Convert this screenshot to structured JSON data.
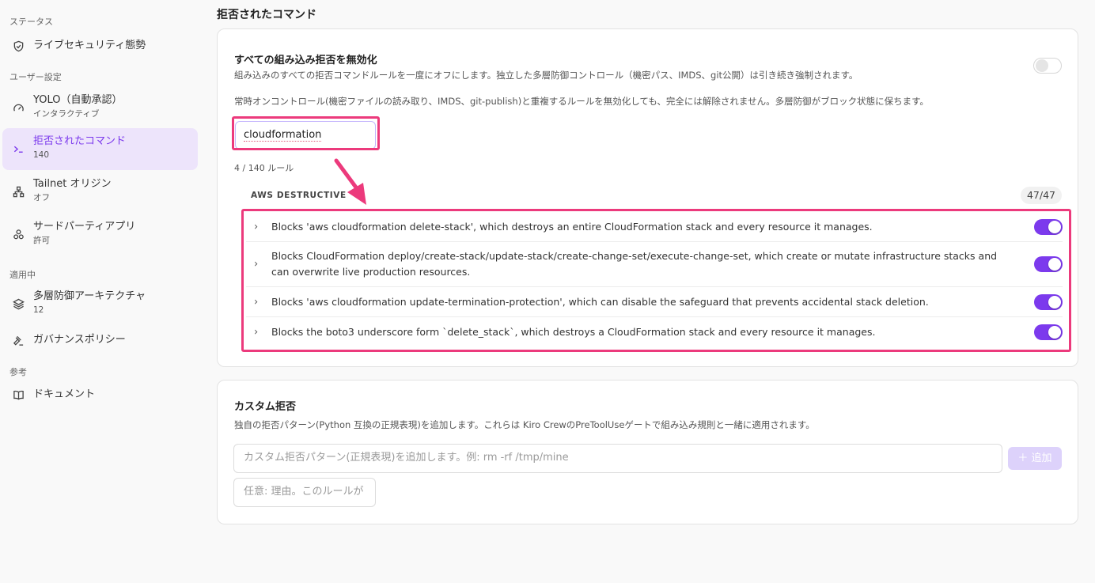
{
  "sidebar": {
    "sections": {
      "status": "ステータス",
      "user_settings": "ユーザー設定",
      "applied": "適用中",
      "reference": "参考"
    },
    "items": [
      {
        "label": "ライブセキュリティ態勢",
        "sub": "",
        "icon": "shield-icon"
      },
      {
        "label": "YOLO（自動承認）",
        "sub": "インタラクティブ",
        "icon": "gauge-icon"
      },
      {
        "label": "拒否されたコマンド",
        "sub": "140",
        "icon": "terminal-icon"
      },
      {
        "label": "Tailnet オリジン",
        "sub": "オフ",
        "icon": "network-icon"
      },
      {
        "label": "サードパーティアプリ",
        "sub": "許可",
        "icon": "apps-icon"
      },
      {
        "label": "多層防御アーキテクチャ",
        "sub": "12",
        "icon": "layers-icon"
      },
      {
        "label": "ガバナンスポリシー",
        "sub": "",
        "icon": "gavel-icon"
      },
      {
        "label": "ドキュメント",
        "sub": "",
        "icon": "book-icon"
      }
    ]
  },
  "main": {
    "title": "拒否されたコマンド",
    "disable_all": {
      "title": "すべての組み込み拒否を無効化",
      "desc1": "組み込みのすべての拒否コマンドルールを一度にオフにします。独立した多層防御コントロール（機密パス、IMDS、git公開）は引き続き強制されます。",
      "desc2": "常時オンコントロール(機密ファイルの読み取り、IMDS、git-publish)と重複するルールを無効化しても、完全には解除されません。多層防御がブロック状態に保ちます。",
      "enabled": false
    },
    "search": {
      "value": "cloudformation"
    },
    "rule_count": "4 / 140 ルール",
    "group": {
      "name": "AWS DESTRUCTIVE",
      "count": "47/47",
      "rules": [
        {
          "text": "Blocks 'aws cloudformation delete-stack', which destroys an entire CloudFormation stack and every resource it manages.",
          "enabled": true
        },
        {
          "text": "Blocks CloudFormation deploy/create-stack/update-stack/create-change-set/execute-change-set, which create or mutate infrastructure stacks and can overwrite live production resources.",
          "enabled": true
        },
        {
          "text": "Blocks 'aws cloudformation update-termination-protection', which can disable the safeguard that prevents accidental stack deletion.",
          "enabled": true
        },
        {
          "text": "Blocks the boto3 underscore form `delete_stack`, which destroys a CloudFormation stack and every resource it manages.",
          "enabled": true
        }
      ]
    },
    "custom": {
      "title": "カスタム拒否",
      "desc": "独自の拒否パターン(Python 互換の正規表現)を追加します。これらは Kiro CrewのPreToolUseゲートで組み込み規則と一緒に適用されます。",
      "pattern_placeholder": "カスタム拒否パターン(正規表現)を追加します。例: rm -rf /tmp/mine",
      "reason_placeholder": "任意: 理由。このルールが",
      "add_label": "＋ 追加"
    }
  },
  "colors": {
    "accent": "#7c3aed",
    "annotation": "#ec3a7c"
  }
}
